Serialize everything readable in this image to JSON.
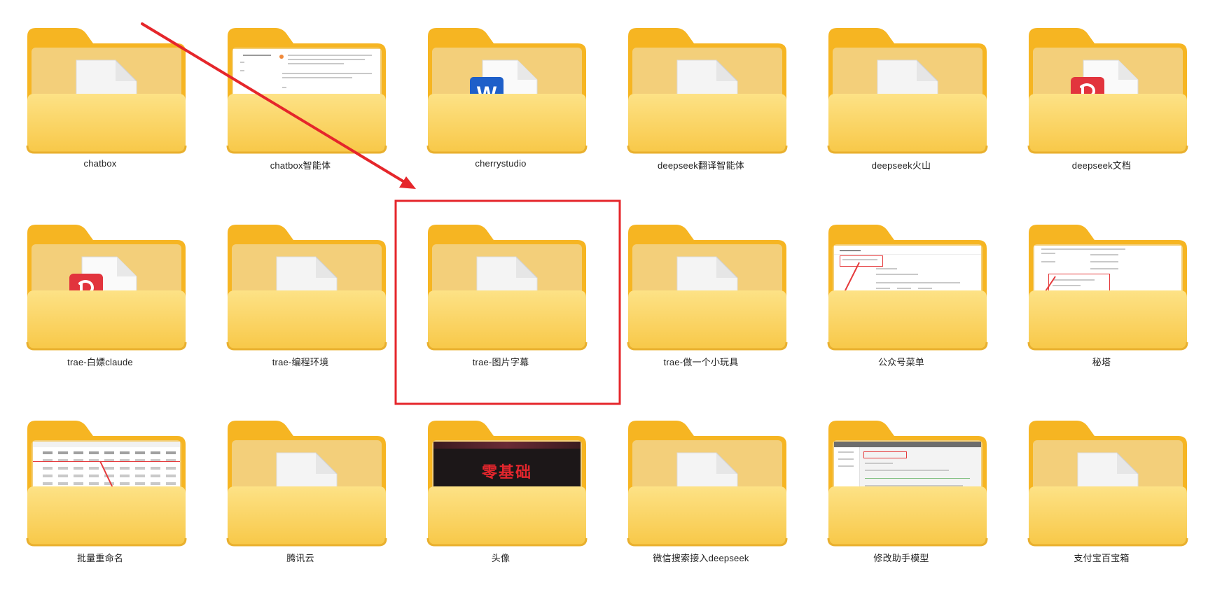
{
  "folders": [
    {
      "label": "chatbox",
      "thumb": "blank-doc"
    },
    {
      "label": "chatbox智能体",
      "thumb": "screenshot-doc"
    },
    {
      "label": "cherrystudio",
      "thumb": "word-doc"
    },
    {
      "label": "deepseek翻译智能体",
      "thumb": "blank-doc"
    },
    {
      "label": "deepseek火山",
      "thumb": "blank-doc"
    },
    {
      "label": "deepseek文档",
      "thumb": "pdf-doc"
    },
    {
      "label": "trae-白嫖claude",
      "thumb": "pdf-doc"
    },
    {
      "label": "trae-编程环境",
      "thumb": "blank-doc"
    },
    {
      "label": "trae-图片字幕",
      "thumb": "blank-doc",
      "highlighted": true
    },
    {
      "label": "trae-做一个小玩具",
      "thumb": "blank-doc"
    },
    {
      "label": "公众号菜单",
      "thumb": "screenshot-settings"
    },
    {
      "label": "秘塔",
      "thumb": "screenshot-list"
    },
    {
      "label": "批量重命名",
      "thumb": "screenshot-table"
    },
    {
      "label": "腾讯云",
      "thumb": "blank-doc"
    },
    {
      "label": "头像",
      "thumb": "image-dark"
    },
    {
      "label": "微信搜索接入deepseek",
      "thumb": "blank-doc"
    },
    {
      "label": "修改助手模型",
      "thumb": "screenshot-model"
    },
    {
      "label": "支付宝百宝箱",
      "thumb": "blank-doc"
    }
  ],
  "thumb_text": {
    "word_letter": "W",
    "image_caption": "零基础"
  },
  "annotations": {
    "arrow_color": "#e5262b",
    "highlight_color": "#e5262b"
  },
  "colors": {
    "folder_back": "#f6b522",
    "folder_front_top": "#fde286",
    "folder_front_bottom": "#f8c848",
    "label_text": "#1f1f1f"
  }
}
